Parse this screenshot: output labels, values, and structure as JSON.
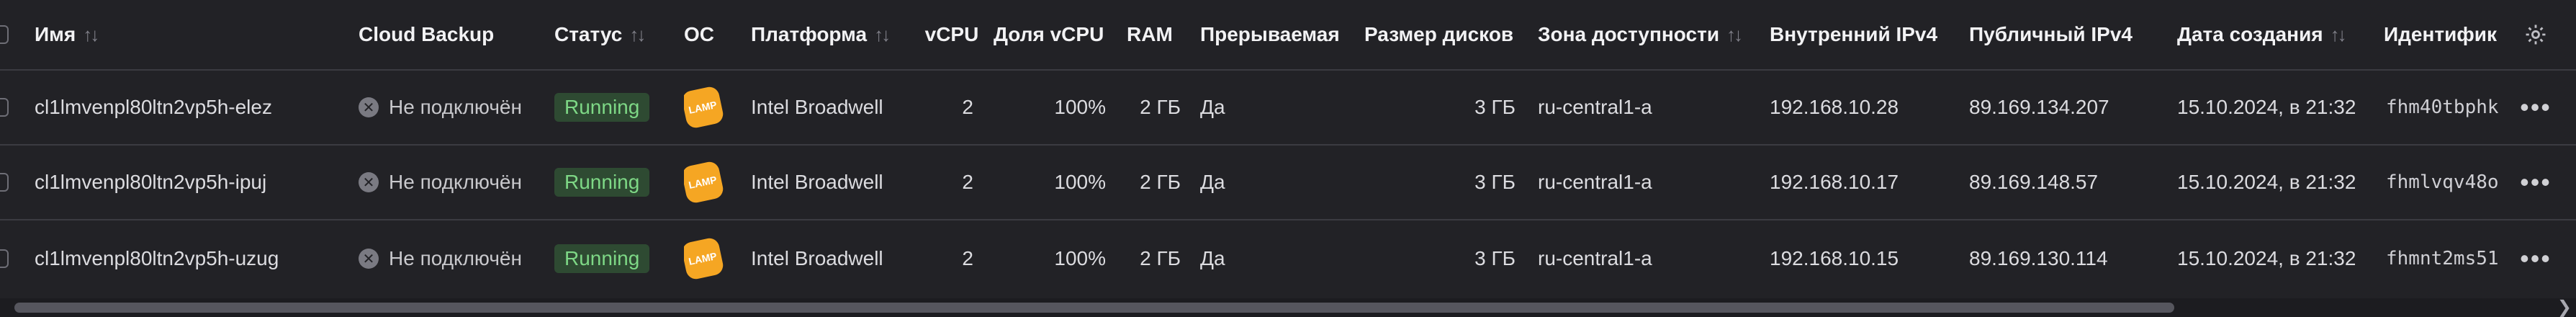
{
  "columns": {
    "name": "Имя",
    "cloud_backup": "Cloud Backup",
    "status": "Статус",
    "os": "ОС",
    "platform": "Платформа",
    "vcpu": "vCPU",
    "vcpu_share": "Доля vCPU",
    "ram": "RAM",
    "preemptible": "Прерываемая",
    "disk_size": "Размер дисков",
    "zone": "Зона доступности",
    "internal_ip": "Внутренний IPv4",
    "public_ip": "Публичный IPv4",
    "created": "Дата создания",
    "id": "Идентифик"
  },
  "sort_glyph": "↑↓",
  "icons": {
    "gear": "gear-icon",
    "close_circle": "close-circle-icon",
    "lamp": "lamp-os-icon",
    "more": "more-horizontal-icon",
    "scroll_right": "chevron-right-icon"
  },
  "colors": {
    "background": "#222226",
    "status_running_bg": "#2e4a32",
    "status_running_text": "#7ed886",
    "lamp_badge": "#f5a623"
  },
  "rows": [
    {
      "name": "cl1lmvenpl80ltn2vp5h-elez",
      "cloud_backup": "Не подключён",
      "status": "Running",
      "os": "LAMP",
      "platform": "Intel Broadwell",
      "vcpu": "2",
      "vcpu_share": "100%",
      "ram": "2 ГБ",
      "preemptible": "Да",
      "disk_size": "3 ГБ",
      "zone": "ru-central1-a",
      "internal_ip": "192.168.10.28",
      "public_ip": "89.169.134.207",
      "created": "15.10.2024, в 21:32",
      "id": "fhm40tbphk",
      "more": "•••"
    },
    {
      "name": "cl1lmvenpl80ltn2vp5h-ipuj",
      "cloud_backup": "Не подключён",
      "status": "Running",
      "os": "LAMP",
      "platform": "Intel Broadwell",
      "vcpu": "2",
      "vcpu_share": "100%",
      "ram": "2 ГБ",
      "preemptible": "Да",
      "disk_size": "3 ГБ",
      "zone": "ru-central1-a",
      "internal_ip": "192.168.10.17",
      "public_ip": "89.169.148.57",
      "created": "15.10.2024, в 21:32",
      "id": "fhmlvqv48o",
      "more": "•••"
    },
    {
      "name": "cl1lmvenpl80ltn2vp5h-uzug",
      "cloud_backup": "Не подключён",
      "status": "Running",
      "os": "LAMP",
      "platform": "Intel Broadwell",
      "vcpu": "2",
      "vcpu_share": "100%",
      "ram": "2 ГБ",
      "preemptible": "Да",
      "disk_size": "3 ГБ",
      "zone": "ru-central1-a",
      "internal_ip": "192.168.10.15",
      "public_ip": "89.169.130.114",
      "created": "15.10.2024, в 21:32",
      "id": "fhmnt2ms51",
      "more": "•••"
    }
  ]
}
